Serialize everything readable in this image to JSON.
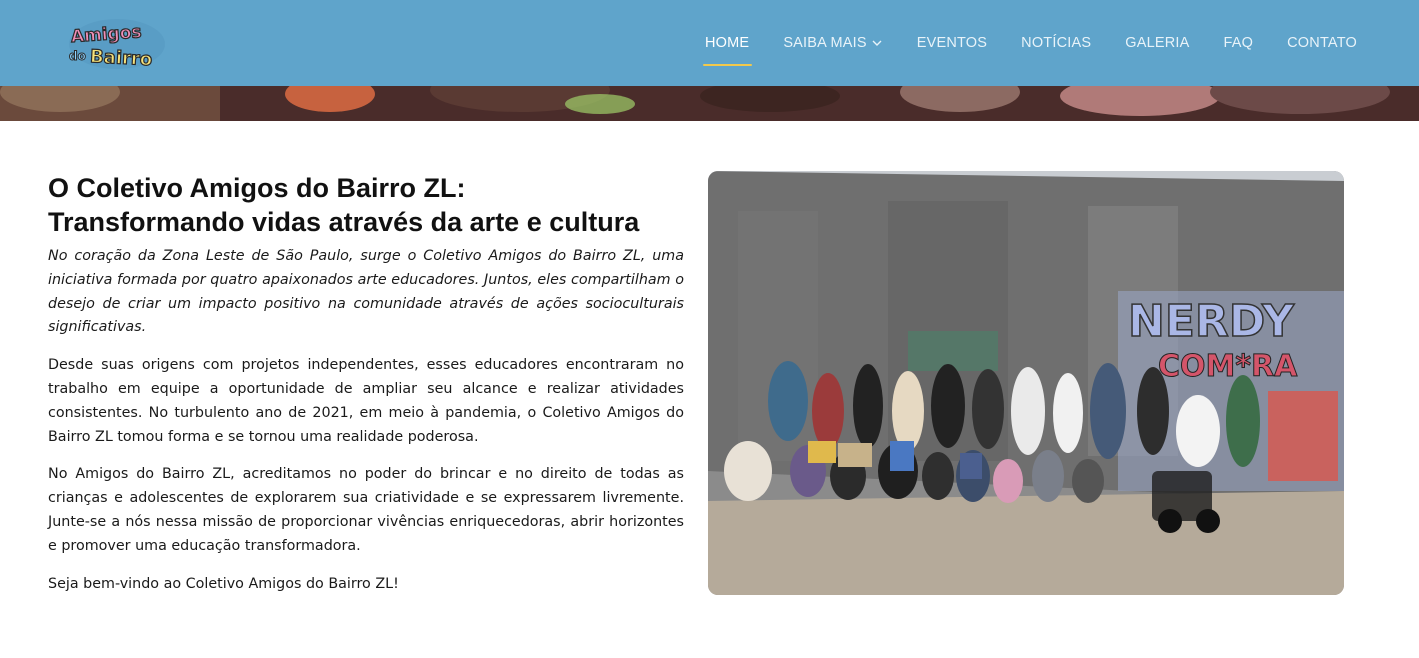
{
  "header": {
    "logo_text": "Amigos do Bairro",
    "nav": [
      {
        "label": "HOME",
        "active": true
      },
      {
        "label": "SAIBA MAIS",
        "dropdown": true
      },
      {
        "label": "EVENTOS"
      },
      {
        "label": "NOTÍCIAS"
      },
      {
        "label": "GALERIA"
      },
      {
        "label": "FAQ"
      },
      {
        "label": "CONTATO"
      }
    ]
  },
  "main": {
    "title_line1": "O Coletivo Amigos do Bairro ZL:",
    "title_line2": "Transformando vidas através da arte e cultura",
    "paragraphs": [
      "No coração da Zona Leste de São Paulo, surge o Coletivo Amigos do Bairro ZL, uma iniciativa formada por quatro apaixonados arte educadores. Juntos, eles compartilham o desejo de criar um impacto positivo na comunidade através de ações socioculturais significativas.",
      "Desde suas origens com projetos independentes, esses educadores encontraram no trabalho em equipe a oportunidade de ampliar seu alcance e realizar atividades consistentes. No turbulento ano de 2021, em meio à pandemia, o Coletivo Amigos do Bairro ZL tomou forma e se tornou uma realidade poderosa.",
      "No Amigos do Bairro ZL, acreditamos no poder do brincar e no direito de todas as crianças e adolescentes de explorarem sua criatividade e se expressarem livremente. Junte-se a nós nessa missão de proporcionar vivências enriquecedoras, abrir horizontes e promover uma educação transformadora.",
      "Seja bem-vindo ao Coletivo Amigos do Bairro ZL!"
    ],
    "photo_graffiti_text": [
      "NERDY",
      "COM*RA"
    ]
  },
  "colors": {
    "navbar": "#5fa4cb",
    "nav_active_underline": "#f2c94c",
    "nav_text": "#e8f3f9",
    "heading": "#111111"
  },
  "icons": {
    "dropdown": "chevron-down-icon"
  }
}
